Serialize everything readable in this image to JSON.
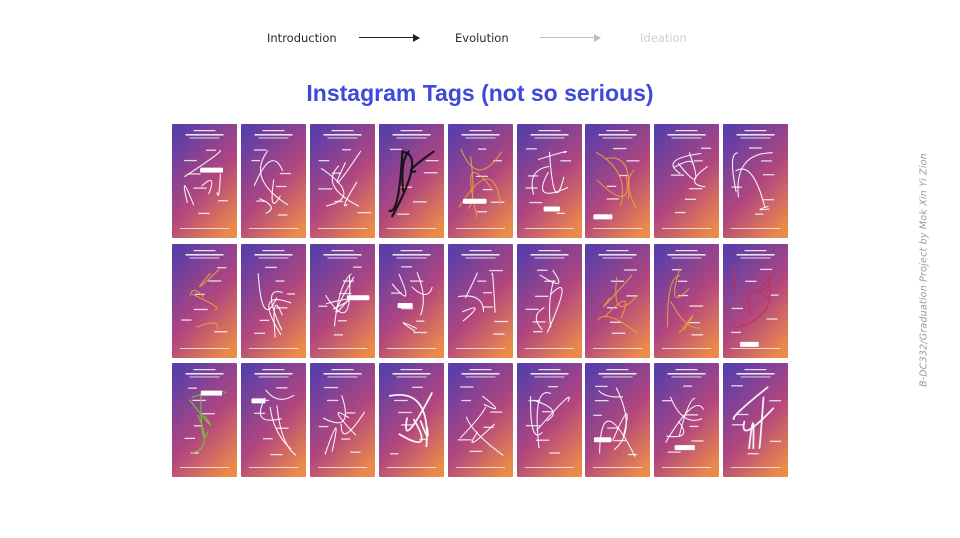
{
  "nav": {
    "steps": [
      "Introduction",
      "Evolution",
      "Ideation"
    ]
  },
  "title": "Instagram Tags (not so serious)",
  "side_text": "B-DC332/Graduation Project by Mok Xin Yi Zion",
  "story_template": {
    "heading_line1": "Dear designers,",
    "heading_line2": "share your design thinking process"
  },
  "gradient_colors": [
    "#5b3ea8",
    "#b1467f",
    "#ec8a4a"
  ],
  "grid": {
    "rows": 3,
    "cols": 9,
    "count": 27
  }
}
